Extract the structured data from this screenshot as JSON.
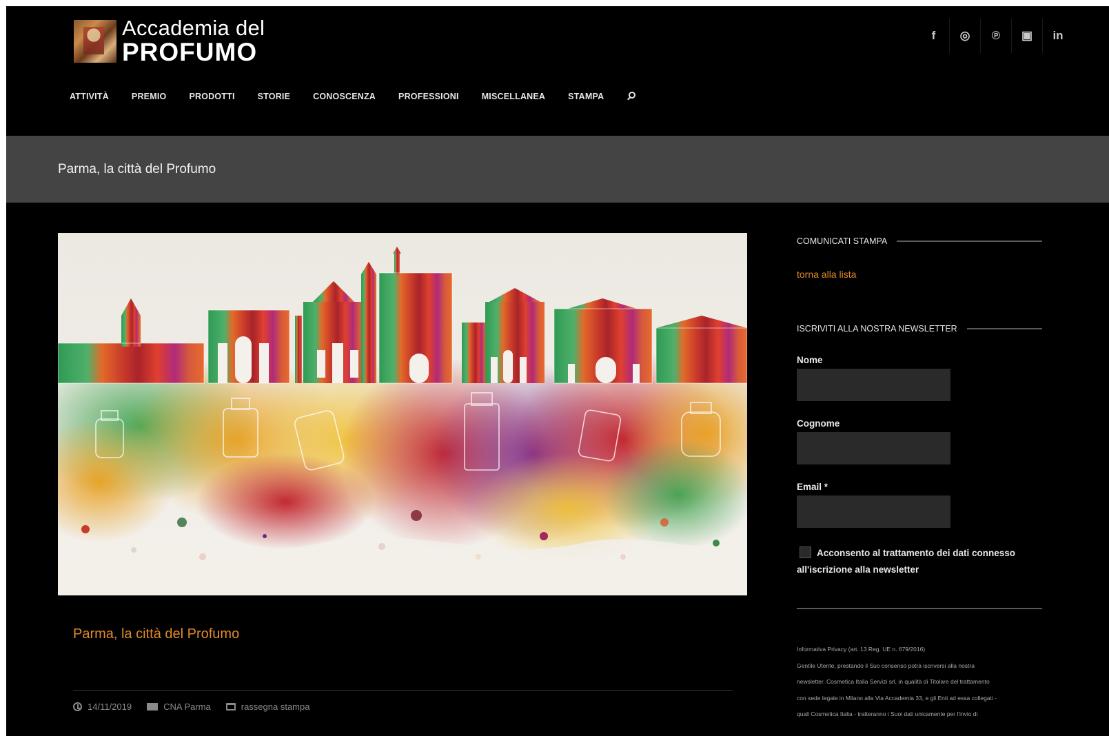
{
  "header": {
    "logo_line1": "Accademia del",
    "logo_line2": "PROFUMO",
    "social": [
      {
        "icon": "facebook-icon",
        "glyph": "f"
      },
      {
        "icon": "instagram-icon",
        "glyph": "◎"
      },
      {
        "icon": "pinterest-icon",
        "glyph": "℗"
      },
      {
        "icon": "youtube-icon",
        "glyph": "▣"
      },
      {
        "icon": "linkedin-icon",
        "glyph": "in"
      }
    ],
    "nav": [
      "ATTIVITÀ",
      "PREMIO",
      "PRODOTTI",
      "STORIE",
      "CONOSCENZA",
      "PROFESSIONI",
      "MISCELLANEA",
      "STAMPA"
    ]
  },
  "page": {
    "title": "Parma, la città del Profumo"
  },
  "article": {
    "title": "Parma, la città del Profumo",
    "date": "14/11/2019",
    "source": "CNA Parma",
    "category": "rassegna stampa"
  },
  "sidebar": {
    "press_heading": "COMUNICATI STAMPA",
    "back_link": "torna alla lista",
    "newsletter_heading": "ISCRIVITI ALLA NOSTRA NEWSLETTER",
    "name_label": "Nome",
    "surname_label": "Cognome",
    "email_label": "Email *",
    "consent_text": "Acconsento al trattamento dei dati connesso all'iscrizione alla newsletter",
    "privacy_lines": [
      "Informativa Privacy (art. 13 Reg. UE n. 679/2016)",
      "Gentile Utente, prestando il Suo consenso potrà iscriversi alla nostra",
      "newsletter. Cosmetica Italia Servizi srl, in qualità di Titolare del trattamento",
      "con sede legale in Milano alla Via Accademia 33, e gli Enti ad essa collegati -",
      "quali Cosmetica Italia - tratteranno i Suoi dati unicamente per l'invio di"
    ]
  },
  "colors": {
    "accent": "#e38a2a",
    "background": "#000000",
    "titlebar": "#444444",
    "input": "#2a2a2a"
  }
}
